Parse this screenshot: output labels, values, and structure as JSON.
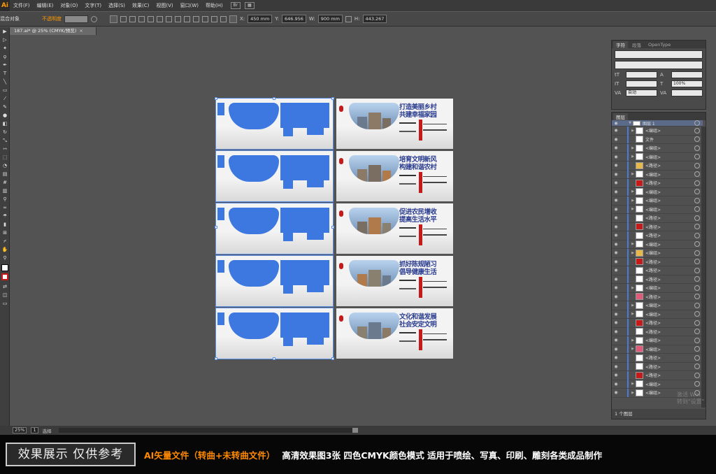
{
  "app": {
    "logo": "Ai"
  },
  "menu": [
    "文件(F)",
    "编辑(E)",
    "对象(O)",
    "文字(T)",
    "选择(S)",
    "效果(C)",
    "视图(V)",
    "窗口(W)",
    "帮助(H)"
  ],
  "control_bar": {
    "selection_label": "混合对象",
    "opacity_label": "不透明度",
    "x_value": "450 mm",
    "y_value": "646.956",
    "w_value": "900 mm",
    "h_value": "443.267"
  },
  "document_tab": {
    "title": "187.ai* @ 25% (CMYK/预览)",
    "close": "×"
  },
  "artboard_cards": [
    {
      "title1": "打造美丽乡村",
      "title2": "共建幸福家园"
    },
    {
      "title1": "培育文明新风",
      "title2": "构建和谐农村"
    },
    {
      "title1": "促进农民增收",
      "title2": "提高生活水平"
    },
    {
      "title1": "抓好陈规陋习",
      "title2": "倡导健康生活"
    },
    {
      "title1": "文化和谐发展",
      "title2": "社会安定文明"
    }
  ],
  "char_panel": {
    "tabs": [
      "字符",
      "段落",
      "OpenType"
    ],
    "leading_auto": "自动",
    "scale": "100%"
  },
  "layers_panel": {
    "tab": "图层",
    "top_layer": "图层 1",
    "rows": [
      "<编组>",
      "文件",
      "<编组>",
      "<编组>",
      "<路径>",
      "<编组>",
      "<路径>",
      "<编组>",
      "<编组>",
      "<编组>",
      "<路径>",
      "<路径>",
      "<路径>",
      "<编组>",
      "<编组>",
      "<路径>",
      "<路径>",
      "<路径>",
      "<编组>",
      "<路径>",
      "<编组>",
      "<编组>",
      "<路径>",
      "<路径>",
      "<编组>",
      "<编组>",
      "<路径>",
      "<路径>",
      "<路径>",
      "<编组>",
      "<编组>"
    ],
    "footer": "1 个图层"
  },
  "watermark": {
    "line1": "激活 Win",
    "line2": "转到\"设置\""
  },
  "status_bar": {
    "zoom": "25%",
    "page": "1",
    "mode": "选择"
  },
  "banner": {
    "badge": "效果展示 仅供参考",
    "orange": "AI矢量文件（转曲+未转曲文件）",
    "white": "高清效果图3张  四色CMYK颜色模式 适用于喷绘、写真、印刷、雕刻各类成品制作"
  },
  "colors": {
    "accent_orange": "#ff8a00",
    "selection_blue": "#3d78e0",
    "title_navy": "#2a3c8f",
    "red": "#c41a1a"
  }
}
